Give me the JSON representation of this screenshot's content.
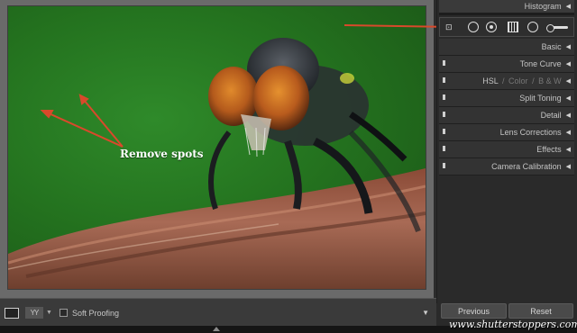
{
  "photo": {
    "annotation": "Remove spots"
  },
  "toolbar": {
    "compare_icon": "YY",
    "soft_proofing_label": "Soft Proofing"
  },
  "panel": {
    "histogram_label": "Histogram",
    "sections": [
      {
        "label": "Basic"
      },
      {
        "label": "Tone Curve"
      },
      {
        "label": "HSL",
        "sub": [
          "Color",
          "B & W"
        ]
      },
      {
        "label": "Split Toning"
      },
      {
        "label": "Detail"
      },
      {
        "label": "Lens Corrections"
      },
      {
        "label": "Effects"
      },
      {
        "label": "Camera Calibration"
      }
    ],
    "tools": [
      "crop-icon",
      "spot-removal-icon",
      "red-eye-icon",
      "graduated-filter-icon",
      "radial-filter-icon",
      "adjustment-brush-icon"
    ]
  },
  "footer": {
    "previous_label": "Previous",
    "reset_label": "Reset"
  },
  "watermark": "www.shutterstoppers.com",
  "colors": {
    "annotation_arrow": "#d9492b",
    "background_green": "#24731f"
  }
}
